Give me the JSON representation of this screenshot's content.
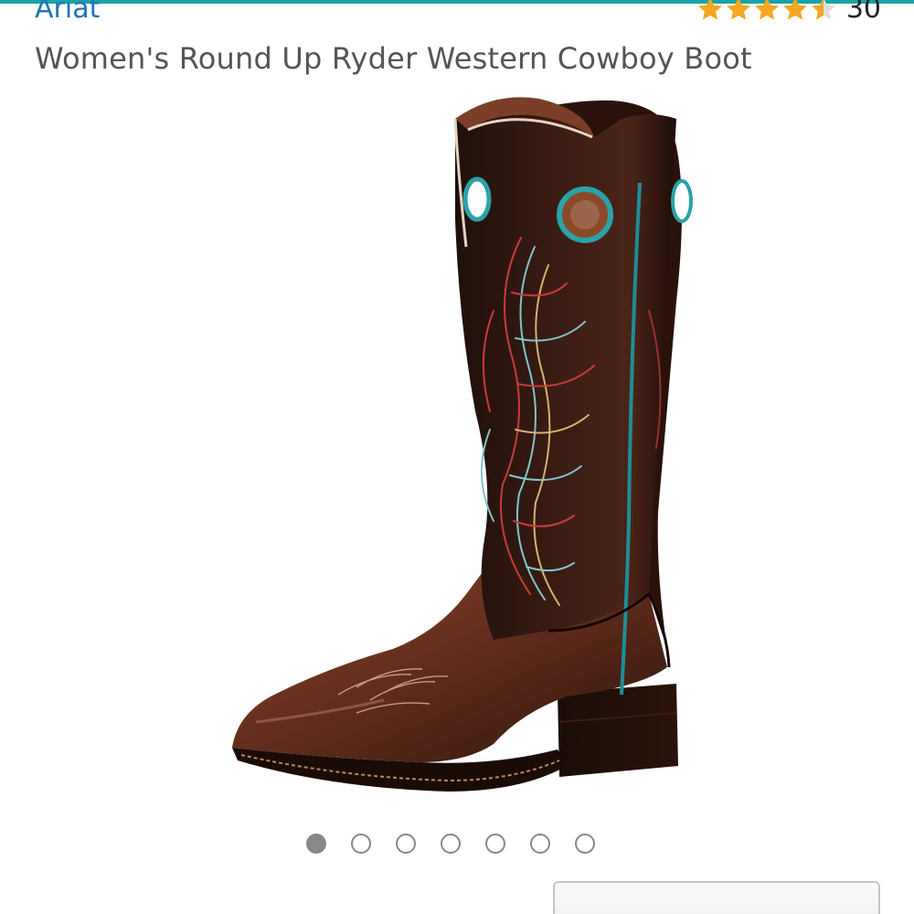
{
  "header": {
    "accent_color": "#1aa3a5"
  },
  "product": {
    "brand": "Ariat",
    "brand_color": "#1f74b8",
    "title": "Women's Round Up Ryder Western Cowboy Boot",
    "rating": {
      "stars": 4.5,
      "max_stars": 5,
      "count": "30",
      "star_color": "#f5a623"
    }
  },
  "gallery": {
    "total_images": 7,
    "active_index": 0,
    "image_icon": "cowboy-boot"
  }
}
